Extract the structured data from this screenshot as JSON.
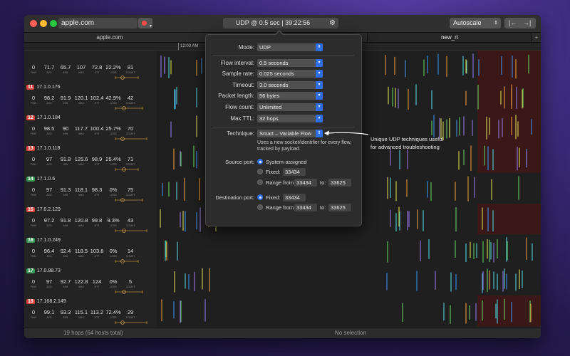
{
  "toolbar": {
    "search_value": "apple.com",
    "status_text": "UDP @ 0.5 sec  |  39:22:56",
    "autoscale": "Autoscale",
    "nav_prev": "|←",
    "nav_next": "→|"
  },
  "tabs": [
    {
      "label": "apple.com"
    },
    {
      "label": "new_rt"
    },
    {
      "label": "+"
    }
  ],
  "timeline": {
    "tick_label": "12:03 AM"
  },
  "stat_labels": [
    "PING",
    "AVG",
    "MIN",
    "MAX",
    "JITT",
    "LOSS",
    "COUNT"
  ],
  "hops": [
    {
      "num": "",
      "host": "",
      "badge": "#000000",
      "vals": [
        "0",
        "71.7",
        "65.7",
        "107",
        "72.8",
        "22.2%",
        "81"
      ]
    },
    {
      "num": "11",
      "host": "17.1.0.176",
      "badge": "#d9423a",
      "vals": [
        "0",
        "98.2",
        "91.9",
        "120.1",
        "102.4",
        "42.9%",
        "42"
      ]
    },
    {
      "num": "12",
      "host": "17.1.0.184",
      "badge": "#d9423a",
      "vals": [
        "0",
        "98.5",
        "90",
        "117.7",
        "100.4",
        "25.7%",
        "70"
      ]
    },
    {
      "num": "13",
      "host": "17.1.0.118",
      "badge": "#d9423a",
      "vals": [
        "0",
        "97",
        "91.8",
        "125.6",
        "98.9",
        "25.4%",
        "71"
      ]
    },
    {
      "num": "14",
      "host": "17.1.0.6",
      "badge": "#3a9a5a",
      "vals": [
        "0",
        "97",
        "91.3",
        "118.1",
        "98.3",
        "0%",
        "75"
      ]
    },
    {
      "num": "15",
      "host": "17.0.2.129",
      "badge": "#d9423a",
      "vals": [
        "0",
        "97.2",
        "91.8",
        "120.8",
        "99.8",
        "9.3%",
        "43"
      ]
    },
    {
      "num": "16",
      "host": "17.1.0.249",
      "badge": "#3a9a5a",
      "vals": [
        "0",
        "96.4",
        "92.4",
        "118.5",
        "103.8",
        "0%",
        "14"
      ]
    },
    {
      "num": "17",
      "host": "17.0.88.73",
      "badge": "#3a9a5a",
      "vals": [
        "0",
        "97",
        "92.7",
        "122.8",
        "124",
        "0%",
        "5"
      ]
    },
    {
      "num": "18",
      "host": "17.168.2.149",
      "badge": "#d9423a",
      "vals": [
        "0",
        "99.1",
        "93.3",
        "115.1",
        "113.2",
        "72.4%",
        "29"
      ]
    }
  ],
  "statusbar": {
    "hops_text": "19 hops (64 hosts total)",
    "selection_text": "No selection"
  },
  "popover": {
    "mode_label": "Mode:",
    "mode_value": "UDP",
    "flow_interval_label": "Flow interval:",
    "flow_interval_value": "0.5 seconds",
    "sample_rate_label": "Sample rate:",
    "sample_rate_value": "0.025 seconds",
    "timeout_label": "Timeout:",
    "timeout_value": "3.0 seconds",
    "packet_length_label": "Packet length:",
    "packet_length_value": "56 bytes",
    "flow_count_label": "Flow count:",
    "flow_count_value": "Unlimited",
    "max_ttl_label": "Max TTL:",
    "max_ttl_value": "32 hops",
    "technique_label": "Technique:",
    "technique_value": "Smart – Variable Flow",
    "technique_desc": "Uses a new socket/identifier for every flow, tracked by payload.",
    "source_port_label": "Source port:",
    "src_system_assigned": "System-assigned",
    "src_fixed_label": "Fixed:",
    "src_fixed_value": "33434",
    "src_range_label": "Range from:",
    "src_range_from": "33434",
    "src_range_to_label": "to:",
    "src_range_to": "33625",
    "dest_port_label": "Destination port:",
    "dst_fixed_label": "Fixed:",
    "dst_fixed_value": "33434",
    "dst_range_label": "Range from:",
    "dst_range_from": "33434",
    "dst_range_to_label": "to:",
    "dst_range_to": "33625"
  },
  "callout": {
    "line1": "Unique UDP techniques useful",
    "line2": "for advanced troubleshooting"
  },
  "colors": {
    "accent": "#2f6fe6",
    "loss_red": "#d9423a",
    "ok_green": "#3a9a5a"
  }
}
